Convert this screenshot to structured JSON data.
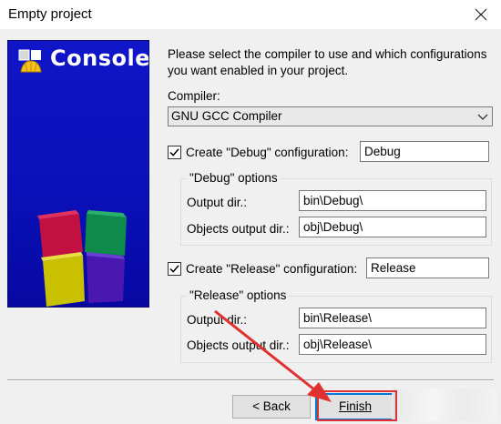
{
  "window": {
    "title": "Empty project",
    "close_icon": "close-icon"
  },
  "banner": {
    "title": "Console",
    "logo_icon": "codeblocks-logo-icon",
    "colors": {
      "background": "#0a10b8"
    }
  },
  "intro": "Please select the compiler to use and which configurations you want enabled in your project.",
  "compiler": {
    "label": "Compiler:",
    "selected": "GNU GCC Compiler"
  },
  "debug": {
    "checkbox_label": "Create \"Debug\" configuration:",
    "checked": true,
    "name_value": "Debug",
    "group_title": "\"Debug\" options",
    "output_dir_label": "Output dir.:",
    "output_dir_value": "bin\\Debug\\",
    "objects_dir_label": "Objects output dir.:",
    "objects_dir_value": "obj\\Debug\\"
  },
  "release": {
    "checkbox_label": "Create \"Release\" configuration:",
    "checked": true,
    "name_value": "Release",
    "group_title": "\"Release\" options",
    "output_dir_label": "Output dir.:",
    "output_dir_value": "bin\\Release\\",
    "objects_dir_label": "Objects output dir.:",
    "objects_dir_value": "obj\\Release\\"
  },
  "buttons": {
    "back": "< Back",
    "finish": "Finish"
  },
  "colors": {
    "accent": "#0078d7",
    "annotation_arrow": "#e03030"
  }
}
